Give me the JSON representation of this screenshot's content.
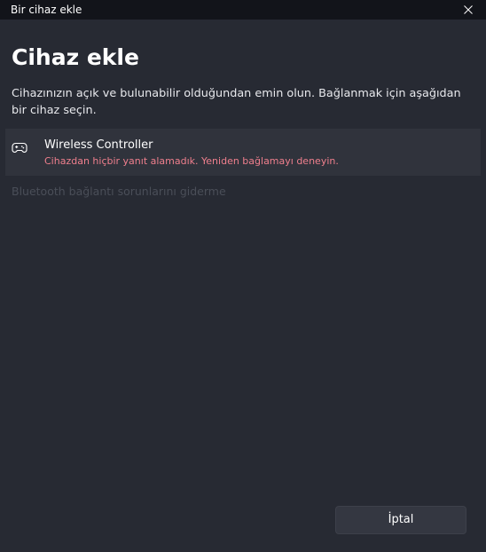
{
  "window": {
    "title": "Bir cihaz ekle"
  },
  "header": {
    "title": "Cihaz ekle",
    "description": "Cihazınızın açık ve bulunabilir olduğundan emin olun. Bağlanmak için aşağıdan bir cihaz seçin."
  },
  "devices": [
    {
      "name": "Wireless Controller",
      "status": "Cihazdan hiçbir yanıt alamadık. Yeniden bağlamayı deneyin.",
      "icon": "gamepad-icon"
    }
  ],
  "links": {
    "troubleshoot": "Bluetooth bağlantı sorunlarını giderme"
  },
  "footer": {
    "cancel_label": "İptal"
  },
  "colors": {
    "background": "#272a33",
    "titlebar": "#12141a",
    "error_text": "#ef7f8d",
    "disabled_link": "#4a4e58"
  }
}
